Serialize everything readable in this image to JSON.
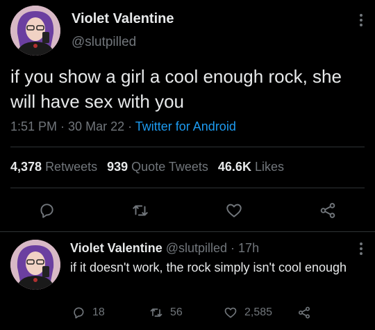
{
  "tweet": {
    "author_name": "Violet Valentine",
    "author_handle": "@slutpilled",
    "text": "if you show a girl a cool enough rock, she will have sex with you",
    "time": "1:51 PM",
    "date": "30 Mar 22",
    "source": "Twitter for Android",
    "sep": " · "
  },
  "stats": {
    "retweets_count": "4,378",
    "retweets_label": "Retweets",
    "quotes_count": "939",
    "quotes_label": "Quote Tweets",
    "likes_count": "46.6K",
    "likes_label": "Likes"
  },
  "actions": {
    "reply_icon": "reply-icon",
    "retweet_icon": "retweet-icon",
    "like_icon": "heart-icon",
    "share_icon": "share-icon"
  },
  "reply": {
    "author_name": "Violet Valentine",
    "author_handle": "@slutpilled",
    "sep": " · ",
    "age": "17h",
    "text": "if it doesn't work, the rock simply isn't cool enough",
    "reply_count": "18",
    "retweet_count": "56",
    "like_count": "2,585"
  },
  "colors": {
    "background": "#000000",
    "text": "#e7e9ea",
    "muted": "#71767b",
    "link": "#1d9bf0",
    "divider": "#2f3336"
  }
}
